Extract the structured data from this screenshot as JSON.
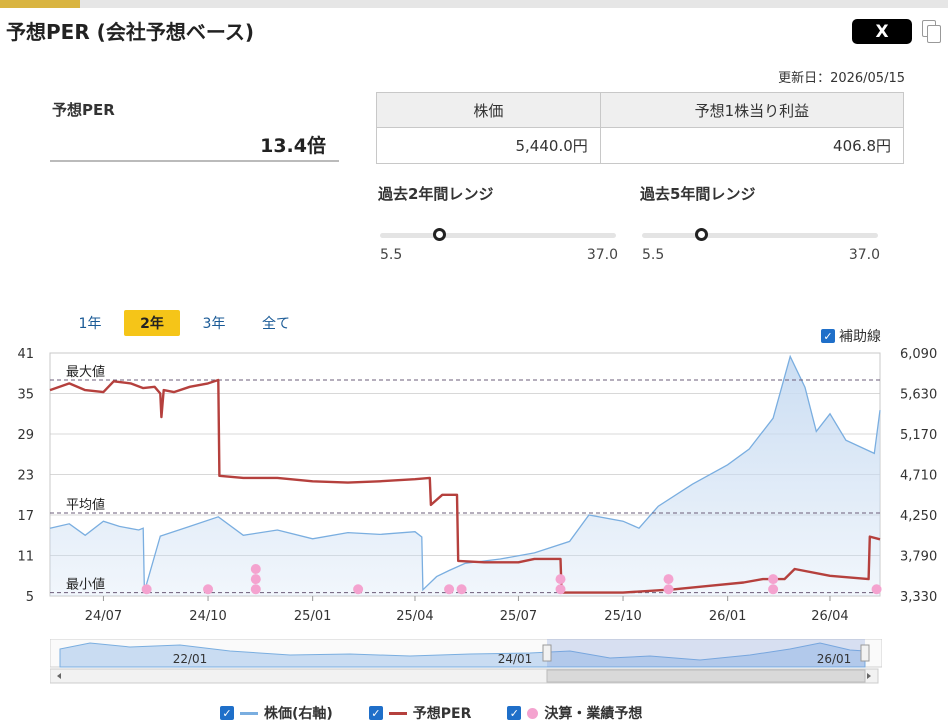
{
  "header": {
    "title": "予想PER (会社予想ベース)",
    "share_x_label": "X",
    "updated": "更新日：2026/05/15"
  },
  "summary": {
    "per_label": "予想PER",
    "per_value": "13.4倍"
  },
  "table": {
    "headers": [
      "株価",
      "予想1株当り利益"
    ],
    "values": [
      "5,440.0円",
      "406.8円"
    ]
  },
  "ranges": [
    {
      "label": "過去2年間レンジ",
      "min": "5.5",
      "max": "37.0",
      "value": 13.4
    },
    {
      "label": "過去5年間レンジ",
      "min": "5.5",
      "max": "37.0",
      "value": 13.4
    }
  ],
  "period_tabs": [
    {
      "label": "1年",
      "active": false
    },
    {
      "label": "2年",
      "active": true
    },
    {
      "label": "3年",
      "active": false
    },
    {
      "label": "全て",
      "active": false
    }
  ],
  "aux_toggle_label": "補助線",
  "legend": {
    "price": "株価(右軸)",
    "per": "予想PER",
    "earnings": "決算・業績予想"
  },
  "colors": {
    "price_line": "#7aaee0",
    "price_fill": "#c9dcf2",
    "per_line": "#b5403d",
    "earnings_dot": "#f4a3cf",
    "accent": "#f5c518"
  },
  "chart_data": {
    "type": "line",
    "x_tick_labels": [
      "24/07",
      "24/10",
      "25/01",
      "25/04",
      "25/07",
      "25/10",
      "26/01",
      "26/04"
    ],
    "y_left": {
      "ticks": [
        "41",
        "35",
        "29",
        "23",
        "17",
        "11",
        "5"
      ],
      "ylim": [
        5,
        41
      ]
    },
    "y_right": {
      "ticks": [
        "6,090",
        "5,630",
        "5,170",
        "4,710",
        "4,250",
        "3,790",
        "3,330"
      ],
      "ylim": [
        3330,
        6090
      ]
    },
    "reference_lines": [
      {
        "label": "最大値",
        "value": 37.0
      },
      {
        "label": "平均値",
        "value": 17.3
      },
      {
        "label": "最小値",
        "value": 5.5
      }
    ],
    "grid": true,
    "series": [
      {
        "name": "予想PER",
        "axis": "left",
        "x": [
          "2024-05-15",
          "2024-06-01",
          "2024-06-15",
          "2024-07-01",
          "2024-07-10",
          "2024-07-25",
          "2024-08-05",
          "2024-08-15",
          "2024-08-20",
          "2024-08-21",
          "2024-08-23",
          "2024-09-01",
          "2024-09-15",
          "2024-10-01",
          "2024-10-10",
          "2024-10-11",
          "2024-11-01",
          "2024-12-01",
          "2025-01-01",
          "2025-02-01",
          "2025-03-01",
          "2025-04-01",
          "2025-04-14",
          "2025-04-15",
          "2025-04-25",
          "2025-05-08",
          "2025-05-09",
          "2025-06-01",
          "2025-07-01",
          "2025-07-15",
          "2025-08-07",
          "2025-08-08",
          "2025-10-01",
          "2025-11-15",
          "2025-12-15",
          "2026-01-15",
          "2026-02-01",
          "2026-02-20",
          "2026-03-01",
          "2026-04-01",
          "2026-05-05",
          "2026-05-06",
          "2026-05-15"
        ],
        "y": [
          35.5,
          36.5,
          35.5,
          35.2,
          36.8,
          36.5,
          35.8,
          36.0,
          35.0,
          31.5,
          35.5,
          35.2,
          36.0,
          36.5,
          37.0,
          22.8,
          22.5,
          22.5,
          22.0,
          21.8,
          22.0,
          22.3,
          22.5,
          18.5,
          20.0,
          20.0,
          10.2,
          10.0,
          10.0,
          10.5,
          10.5,
          5.5,
          5.5,
          6.0,
          6.5,
          7.0,
          7.5,
          7.5,
          9.0,
          8.0,
          7.5,
          13.8,
          13.4
        ]
      },
      {
        "name": "株価(右軸)",
        "axis": "right",
        "x": [
          "2024-05-15",
          "2024-06-01",
          "2024-06-15",
          "2024-07-01",
          "2024-07-15",
          "2024-08-01",
          "2024-08-05",
          "2024-08-06",
          "2024-08-20",
          "2024-09-15",
          "2024-10-10",
          "2024-11-01",
          "2024-12-01",
          "2025-01-01",
          "2025-02-01",
          "2025-03-01",
          "2025-04-01",
          "2025-04-07",
          "2025-04-08",
          "2025-04-20",
          "2025-05-01",
          "2025-05-15",
          "2025-06-15",
          "2025-07-15",
          "2025-08-15",
          "2025-09-01",
          "2025-10-01",
          "2025-10-15",
          "2025-11-01",
          "2025-12-01",
          "2026-01-01",
          "2026-01-20",
          "2026-02-10",
          "2026-02-25",
          "2026-03-10",
          "2026-03-20",
          "2026-04-01",
          "2026-04-15",
          "2026-05-10",
          "2026-05-15"
        ],
        "y": [
          4100,
          4150,
          4020,
          4180,
          4120,
          4080,
          4100,
          3380,
          4010,
          4120,
          4230,
          4020,
          4080,
          3980,
          4050,
          4030,
          4060,
          4000,
          3400,
          3550,
          3620,
          3700,
          3750,
          3820,
          3950,
          4250,
          4180,
          4100,
          4350,
          4600,
          4820,
          5000,
          5350,
          6050,
          5700,
          5200,
          5400,
          5100,
          4950,
          5440
        ]
      }
    ],
    "earnings_markers": [
      {
        "x": "2024-08-08",
        "value": 6.0
      },
      {
        "x": "2024-10-01",
        "value": 6.0
      },
      {
        "x": "2024-11-12",
        "value": 6.0
      },
      {
        "x": "2024-11-12",
        "value": 7.5
      },
      {
        "x": "2024-11-12",
        "value": 9.0
      },
      {
        "x": "2025-02-10",
        "value": 6.0
      },
      {
        "x": "2025-05-01",
        "value": 6.0
      },
      {
        "x": "2025-05-12",
        "value": 6.0
      },
      {
        "x": "2025-08-07",
        "value": 6.0
      },
      {
        "x": "2025-08-07",
        "value": 7.5
      },
      {
        "x": "2025-11-10",
        "value": 6.0
      },
      {
        "x": "2025-11-10",
        "value": 7.5
      },
      {
        "x": "2026-02-10",
        "value": 6.0
      },
      {
        "x": "2026-02-10",
        "value": 7.5
      },
      {
        "x": "2026-05-12",
        "value": 6.0
      }
    ],
    "navigator": {
      "tick_labels": [
        "22/01",
        "24/01",
        "26/01"
      ],
      "selected_range": [
        "2024-05-15",
        "2026-05-15"
      ]
    }
  }
}
